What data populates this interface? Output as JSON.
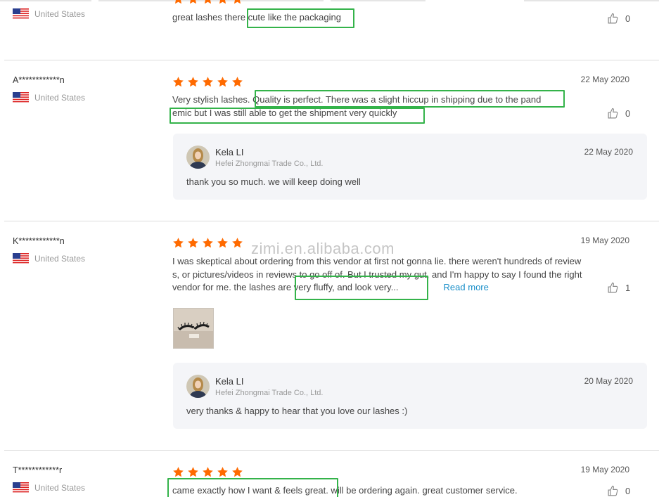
{
  "watermark": "zimi.en.alibaba.com",
  "reviews": [
    {
      "user": "",
      "country": "United States",
      "text": "great lashes there cute like the packaging",
      "likes": "0",
      "rating": 5
    },
    {
      "user": "A************n",
      "country": "United States",
      "date": "22 May 2020",
      "rating": 5,
      "text_line1": "Very stylish lashes. Quality is perfect. There was a slight hiccup in shipping due to the pand",
      "text_line2": "emic but I was still able to get the shipment very quickly",
      "likes": "0",
      "reply": {
        "seller": "Kela LI",
        "company": "Hefei Zhongmai Trade Co., Ltd.",
        "date": "22 May 2020",
        "text": "thank you so much. we will keep doing well"
      }
    },
    {
      "user": "K************n",
      "country": "United States",
      "date": "19 May 2020",
      "rating": 5,
      "text_line1": "I was skeptical about ordering from this vendor at first not gonna lie. there weren't hundreds of review",
      "text_line2": "s, or pictures/videos in reviews to go off of. But I trusted my gut, and I'm happy to say I found the right",
      "text_line3": "vendor for me. the lashes are very fluffy, and look very...",
      "read_more": "Read more",
      "likes": "1",
      "reply": {
        "seller": "Kela LI",
        "company": "Hefei Zhongmai Trade Co., Ltd.",
        "date": "20 May 2020",
        "text": "very thanks & happy to hear that you love our lashes :)"
      }
    },
    {
      "user": "T************r",
      "country": "United States",
      "date": "19 May 2020",
      "rating": 5,
      "text": "came exactly how I want & feels great. will be ordering again. great customer service.",
      "likes": "0"
    }
  ],
  "colors": {
    "star": "#ff6a00",
    "highlight": "#34b34a",
    "link": "#1a8fc9",
    "reply_bg": "#f4f5f8"
  },
  "icons": {
    "star": "star-icon",
    "like": "thumbs-up-icon",
    "flag": "us-flag-icon"
  }
}
